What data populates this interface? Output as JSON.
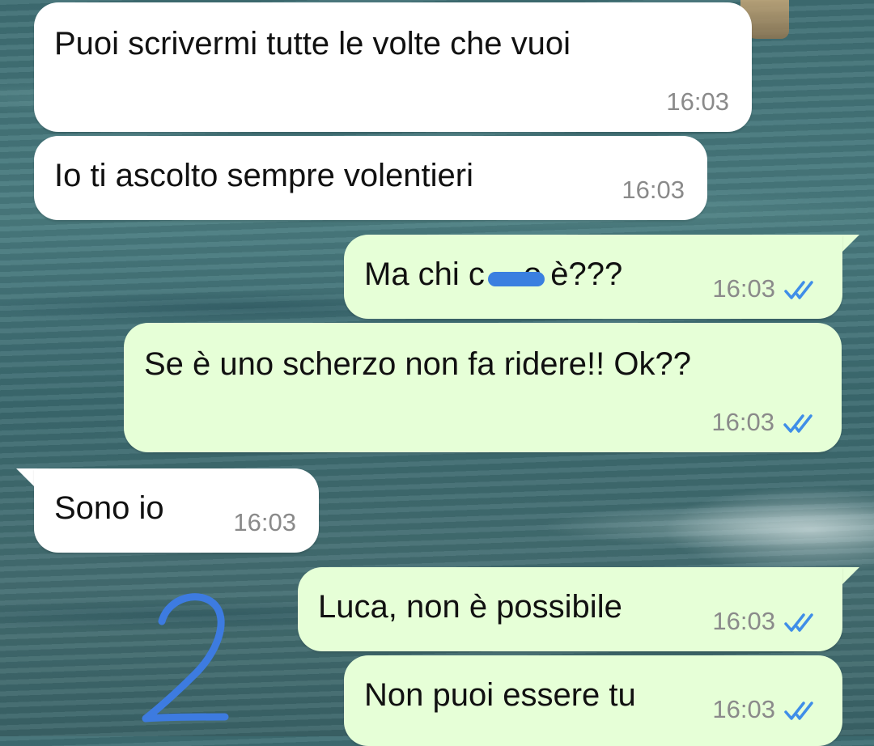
{
  "messages": [
    {
      "direction": "incoming",
      "text": "Puoi scrivermi tutte le volte che vuoi",
      "time": "16:03"
    },
    {
      "direction": "incoming",
      "text": "Io ti ascolto sempre volentieri",
      "time": "16:03"
    },
    {
      "direction": "outgoing",
      "text_before": "Ma chi c",
      "text_after": "o è???",
      "time": "16:03",
      "status": "read"
    },
    {
      "direction": "outgoing",
      "text": "Se è uno scherzo non fa ridere!! Ok??",
      "time": "16:03",
      "status": "read"
    },
    {
      "direction": "incoming",
      "text": "Sono io",
      "time": "16:03"
    },
    {
      "direction": "outgoing",
      "text": "Luca, non è possibile",
      "time": "16:03",
      "status": "read"
    },
    {
      "direction": "outgoing",
      "text": "Non puoi essere tu",
      "time": "16:03",
      "status": "read"
    }
  ],
  "annotation": {
    "number": "2",
    "color": "#3d7be0"
  },
  "colors": {
    "incoming_bubble": "#ffffff",
    "outgoing_bubble": "#e6ffd7",
    "read_ticks": "#3f8ee8",
    "timestamp": "#8a8a8a",
    "redaction": "#3a7fe0"
  }
}
